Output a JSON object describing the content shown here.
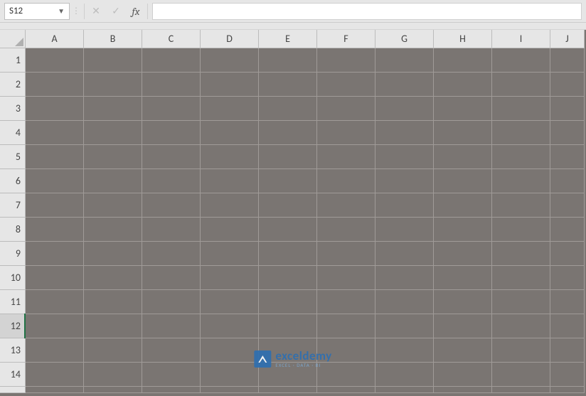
{
  "nameBox": {
    "value": "S12"
  },
  "formulaBar": {
    "value": ""
  },
  "columns": [
    "A",
    "B",
    "C",
    "D",
    "E",
    "F",
    "G",
    "H",
    "I",
    "J"
  ],
  "rows": [
    "1",
    "2",
    "3",
    "4",
    "5",
    "6",
    "7",
    "8",
    "9",
    "10",
    "11",
    "12",
    "13",
    "14"
  ],
  "activeRow": "12",
  "fx": {
    "label": "fx",
    "cancel": "✕",
    "enter": "✓"
  },
  "watermark": {
    "name": "exceldemy",
    "tagline": "EXCEL · DATA · BI"
  }
}
